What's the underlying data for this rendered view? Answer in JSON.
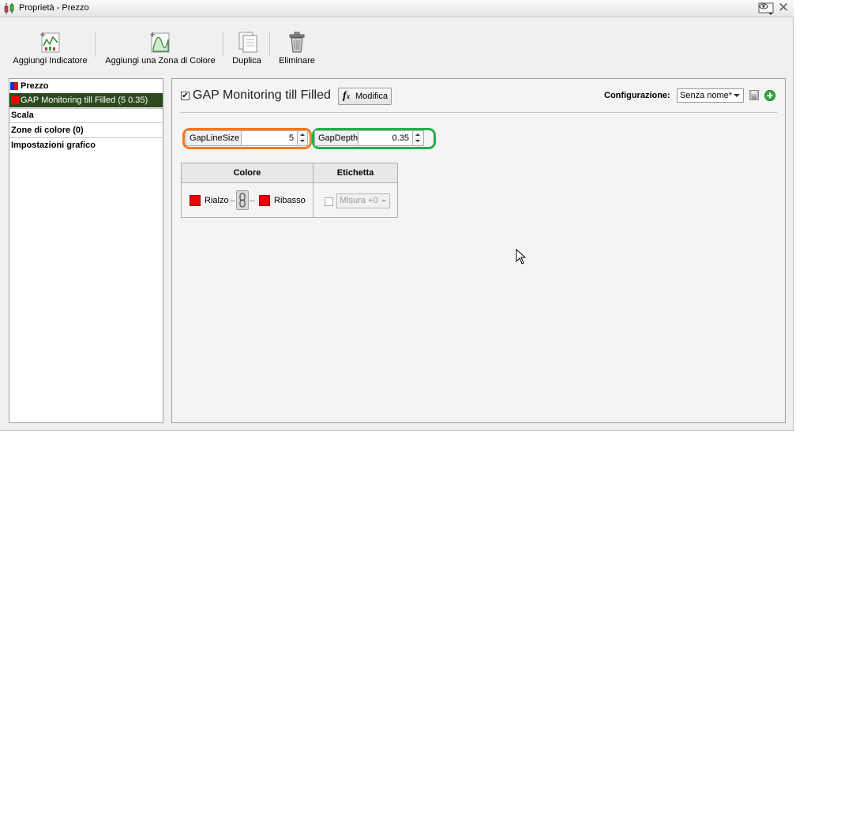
{
  "window": {
    "title": "Proprietà - Prezzo"
  },
  "toolbar": {
    "add_indicator": "Aggiungi Indicatore",
    "add_color_zone": "Aggiungi una Zona di Colore",
    "duplicate": "Duplica",
    "delete": "Eliminare"
  },
  "tree": {
    "price": "Prezzo",
    "indicator": "GAP Monitoring till Filled (5 0.35)",
    "scale": "Scala",
    "color_zones": "Zone di colore (0)",
    "chart_settings": "Impostazioni grafico"
  },
  "indicator": {
    "enabled": true,
    "name": "GAP Monitoring till Filled",
    "edit_label": "Modifica",
    "fx_icon": "fx-icon"
  },
  "config": {
    "label": "Configurazione:",
    "selected": "Senza nome*"
  },
  "params": {
    "gap_line_size": {
      "label": "GapLineSize",
      "value": "5"
    },
    "gap_depth": {
      "label": "GapDepth",
      "value": "0.35"
    }
  },
  "color_table": {
    "col_color": "Colore",
    "col_label": "Etichetta",
    "up_label": "Rialzo",
    "down_label": "Ribasso",
    "up_color": "#ee0000",
    "down_color": "#ee0000",
    "label_enabled": false,
    "label_select": "Misura +0"
  },
  "colors": {
    "selected_row_bg": "#2d4a1e",
    "highlight_orange": "#f07a1e",
    "highlight_green": "#22b04b"
  }
}
